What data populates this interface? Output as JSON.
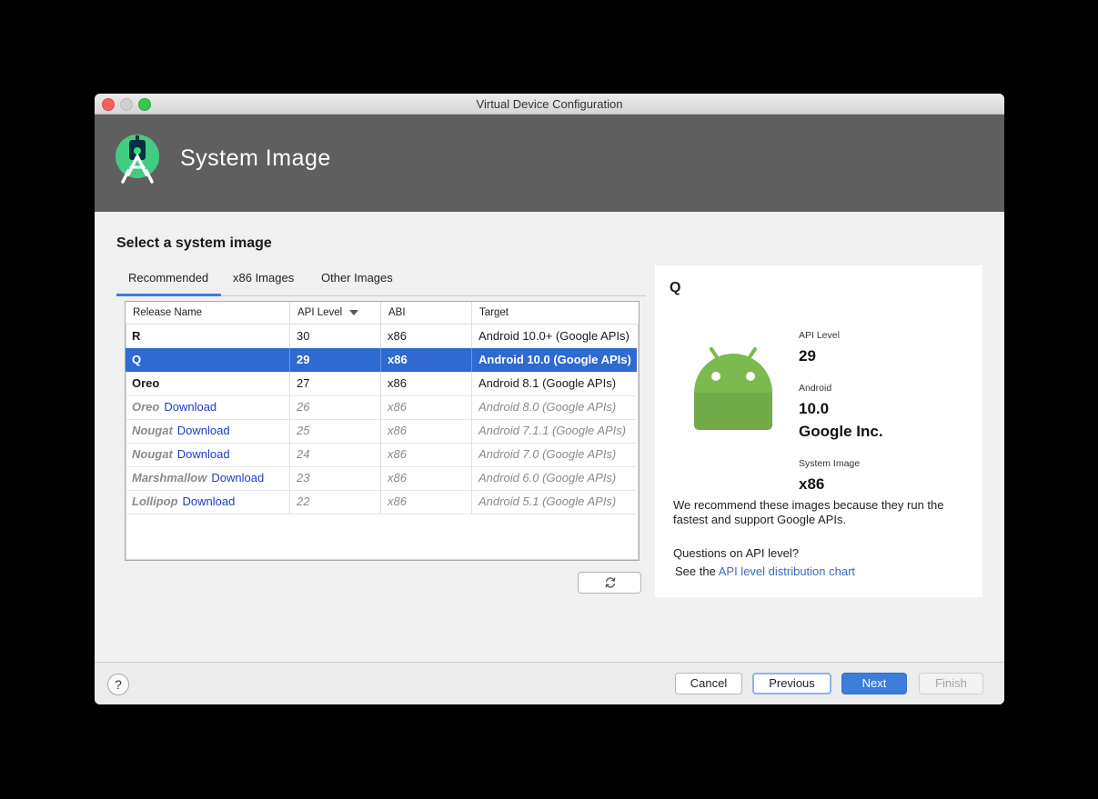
{
  "window": {
    "title": "Virtual Device Configuration"
  },
  "header": {
    "title": "System Image",
    "logo": "android-studio-logo"
  },
  "main": {
    "section_title": "Select a system image",
    "tabs": [
      {
        "label": "Recommended",
        "active": true
      },
      {
        "label": "x86 Images",
        "active": false
      },
      {
        "label": "Other Images",
        "active": false
      }
    ],
    "table": {
      "columns": [
        "Release Name",
        "API Level",
        "ABI",
        "Target"
      ],
      "sorted_column": "API Level",
      "rows": [
        {
          "name": "R",
          "download": "",
          "api": "30",
          "abi": "x86",
          "target": "Android 10.0+ (Google APIs)",
          "state": "installed"
        },
        {
          "name": "Q",
          "download": "",
          "api": "29",
          "abi": "x86",
          "target": "Android 10.0 (Google APIs)",
          "state": "selected"
        },
        {
          "name": "Oreo",
          "download": "",
          "api": "27",
          "abi": "x86",
          "target": "Android 8.1 (Google APIs)",
          "state": "installed"
        },
        {
          "name": "Oreo",
          "download": "Download",
          "api": "26",
          "abi": "x86",
          "target": "Android 8.0 (Google APIs)",
          "state": "not-installed"
        },
        {
          "name": "Nougat",
          "download": "Download",
          "api": "25",
          "abi": "x86",
          "target": "Android 7.1.1 (Google APIs)",
          "state": "not-installed"
        },
        {
          "name": "Nougat",
          "download": "Download",
          "api": "24",
          "abi": "x86",
          "target": "Android 7.0 (Google APIs)",
          "state": "not-installed"
        },
        {
          "name": "Marshmallow",
          "download": "Download",
          "api": "23",
          "abi": "x86",
          "target": "Android 6.0 (Google APIs)",
          "state": "not-installed"
        },
        {
          "name": "Lollipop",
          "download": "Download",
          "api": "22",
          "abi": "x86",
          "target": "Android 5.1 (Google APIs)",
          "state": "not-installed"
        }
      ]
    },
    "refresh_icon": "refresh-icon"
  },
  "detail": {
    "name": "Q",
    "api_level_label": "API Level",
    "api_level": "29",
    "android_label": "Android",
    "android_version": "10.0",
    "vendor": "Google Inc.",
    "system_image_label": "System Image",
    "system_image": "x86",
    "recommend_text": "We recommend these images because they run the fastest and support Google APIs.",
    "question": "Questions on API level?",
    "see_the": "See the",
    "chart_link": "API level distribution chart"
  },
  "footer": {
    "help": "?",
    "cancel": "Cancel",
    "previous": "Previous",
    "next": "Next",
    "finish": "Finish"
  },
  "colors": {
    "accent": "#3b7ddd",
    "selection": "#2f6ad0",
    "header": "#5f5f5f",
    "download_link": "#1f3ad4",
    "android_green": "#7cb94f"
  }
}
